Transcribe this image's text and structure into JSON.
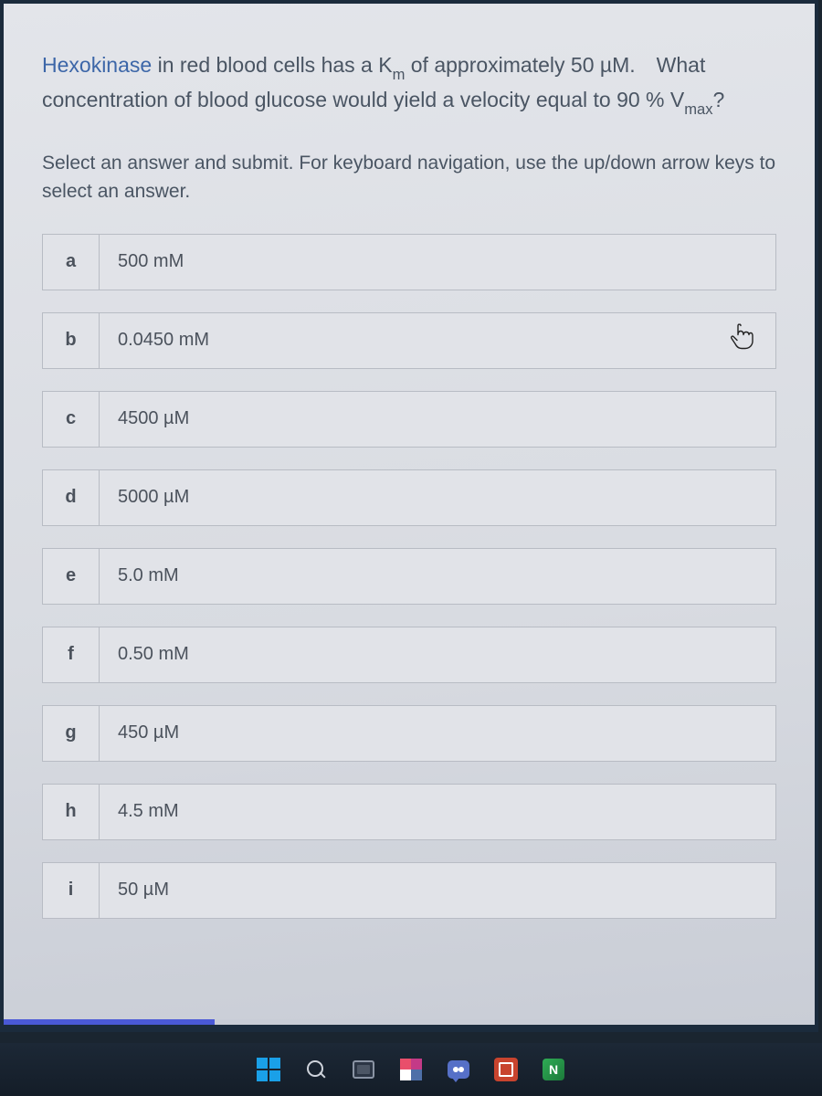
{
  "question": {
    "keyword": "Hexokinase",
    "line1_after_keyword": " in red blood cells has a K",
    "km_sub": "m",
    "line1_tail": " of approximately 50 µM. What",
    "line2_head": "concentration of blood glucose would yield a velocity equal to 90 % V",
    "vmax_sub": "max",
    "line2_tail": "?"
  },
  "instruction": "Select an answer and submit. For keyboard navigation, use the up/down arrow keys to select an answer.",
  "options": [
    {
      "letter": "a",
      "text": "500 mM"
    },
    {
      "letter": "b",
      "text": "0.0450 mM"
    },
    {
      "letter": "c",
      "text": "4500 µM"
    },
    {
      "letter": "d",
      "text": "5000 µM"
    },
    {
      "letter": "e",
      "text": "5.0 mM"
    },
    {
      "letter": "f",
      "text": "0.50 mM"
    },
    {
      "letter": "g",
      "text": "450 µM"
    },
    {
      "letter": "h",
      "text": "4.5 mM"
    },
    {
      "letter": "i",
      "text": "50 µM"
    }
  ],
  "cursor_on_option_index": 1,
  "progress_percent": 26,
  "taskbar": {
    "app_green_letter": "N"
  }
}
